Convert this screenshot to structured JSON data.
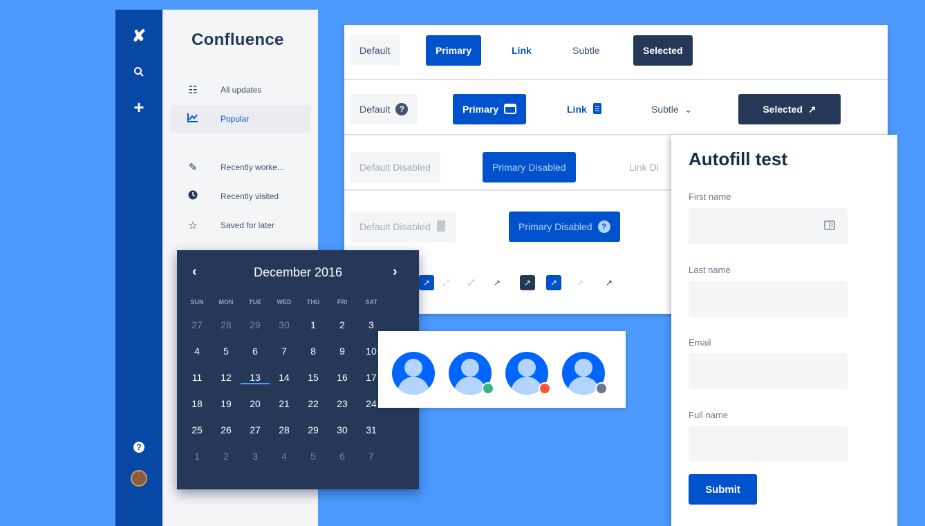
{
  "nav": {
    "brand": "Confluence",
    "items": [
      {
        "label": "All updates",
        "icon": "list-icon"
      },
      {
        "label": "Popular",
        "icon": "chart-icon"
      },
      {
        "label": "Recently worke...",
        "icon": "pencil-icon"
      },
      {
        "label": "Recently visited",
        "icon": "clock-icon"
      },
      {
        "label": "Saved for later",
        "icon": "star-icon"
      }
    ]
  },
  "buttons": {
    "row1": {
      "default": "Default",
      "primary": "Primary",
      "link": "Link",
      "subtle": "Subtle",
      "selected": "Selected"
    },
    "row2": {
      "default": "Default",
      "primary": "Primary",
      "link": "Link",
      "subtle": "Subtle",
      "selected": "Selected"
    },
    "row3": {
      "default": "Default Disabled",
      "primary": "Primary Disabled",
      "link": "Link Di"
    },
    "row4": {
      "default": "Default Disabled",
      "primary": "Primary Disabled"
    }
  },
  "calendar": {
    "month": "December 2016",
    "weekdays": [
      "SUN",
      "MON",
      "TUE",
      "WED",
      "THU",
      "FRI",
      "SAT"
    ],
    "weeks": [
      [
        "27",
        "28",
        "29",
        "30",
        "1",
        "2",
        "3"
      ],
      [
        "4",
        "5",
        "6",
        "7",
        "8",
        "9",
        "10"
      ],
      [
        "11",
        "12",
        "13",
        "14",
        "15",
        "16",
        "17"
      ],
      [
        "18",
        "19",
        "20",
        "21",
        "22",
        "23",
        "24"
      ],
      [
        "25",
        "26",
        "27",
        "28",
        "29",
        "30",
        "31"
      ],
      [
        "1",
        "2",
        "3",
        "4",
        "5",
        "6",
        "7"
      ]
    ],
    "today": "13"
  },
  "avatars": [
    {
      "status": "none"
    },
    {
      "status": "online",
      "color": "#36b37e"
    },
    {
      "status": "busy",
      "color": "#ff5630"
    },
    {
      "status": "offline",
      "color": "#6b778c"
    }
  ],
  "form": {
    "title": "Autofill test",
    "fields": [
      {
        "label": "First name"
      },
      {
        "label": "Last name"
      },
      {
        "label": "Email"
      },
      {
        "label": "Full name"
      }
    ],
    "submit": "Submit"
  },
  "colors": {
    "background": "#4c9aff",
    "rail": "#0747a6",
    "primary": "#0052cc",
    "selected": "#253858"
  }
}
